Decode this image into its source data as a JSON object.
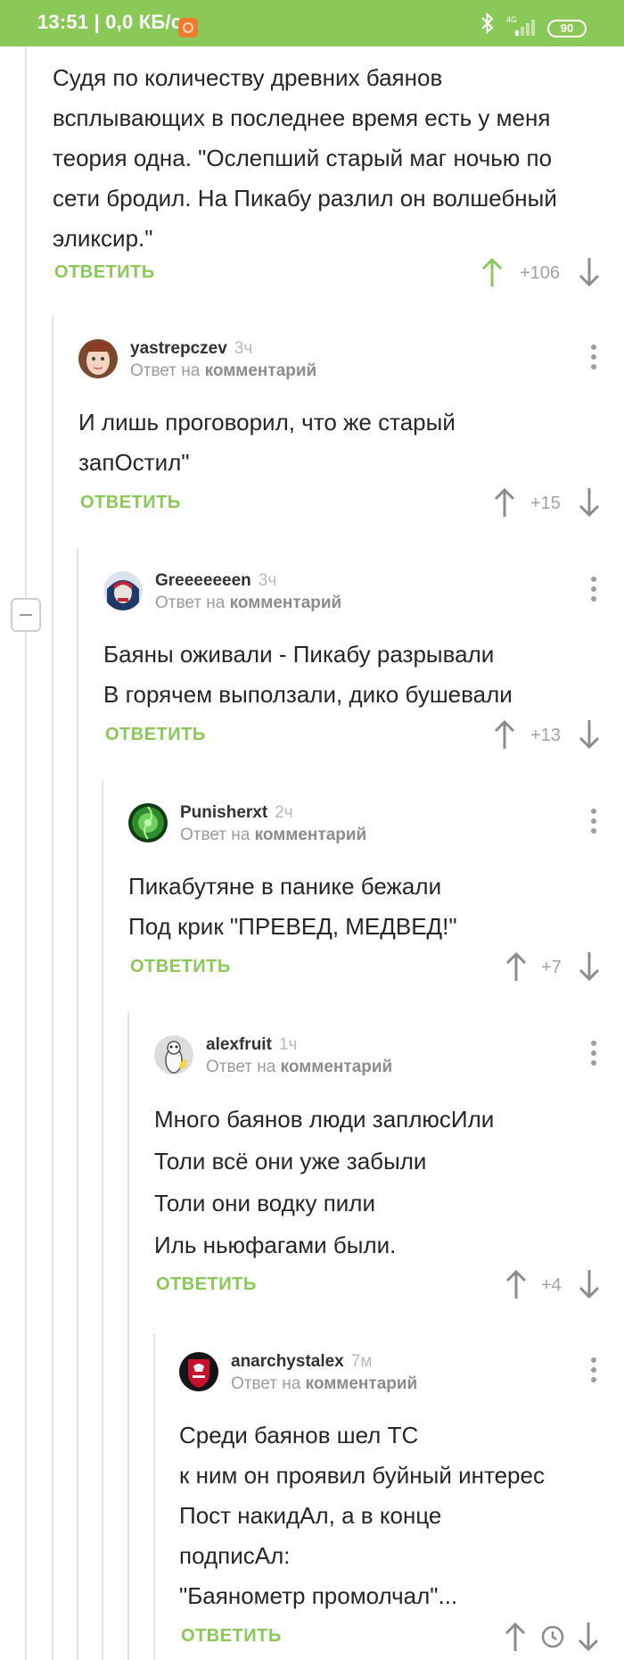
{
  "status_bar": {
    "time_speed": "13:51 | 0,0 КБ/с",
    "network": "4G",
    "battery": "90"
  },
  "icons": {
    "bluetooth": "bluetooth-icon",
    "signal": "signal-icon",
    "notification": "notification-icon",
    "menu": "more-vertical-icon",
    "upvote": "arrow-up-icon",
    "downvote": "arrow-down-icon",
    "collapse": "minus-icon",
    "pending": "clock-icon"
  },
  "colors": {
    "accent": "#8ac858",
    "text": "#262626",
    "muted": "#9c9c9c"
  },
  "reply_on": "Ответ на",
  "reply_target": "комментарий",
  "reply_label": "ОТВЕТИТЬ",
  "comments": [
    {
      "text": "Судя по количеству древних баянов всплывающих в последнее время есть у меня теория одна. \"Ослепший старый маг ночью по сети бродил. На Пикабу разлил он волшебный эликсир.\"",
      "score": "+106"
    },
    {
      "author": "yastrepczev",
      "time": "3ч",
      "text": "И лишь проговорил, что же старый запОстил\"",
      "score": "+15"
    },
    {
      "author": "Greeeeeeen",
      "time": "3ч",
      "text": "Баяны оживали - Пикабу разрывали\nВ горячем выползали, дико бушевали",
      "score": "+13"
    },
    {
      "author": "Punisherxt",
      "time": "2ч",
      "text": "Пикабутяне в панике бежали\nПод крик \"ПРЕВЕД, МЕДВЕД!\"",
      "score": "+7"
    },
    {
      "author": "alexfruit",
      "time": "1ч",
      "text": "Много баянов люди заплюсИли\nТоли всё они уже забыли\nТоли они водку пили\nИль ньюфагами были.",
      "score": "+4"
    },
    {
      "author": "anarchystalex",
      "time": "7м",
      "text": "Среди баянов шел ТС\nк ним он проявил буйный интерес\nПост накидАл, а в конце\nподписАл:\n\"Баянометр промолчал\"...",
      "score": ""
    }
  ]
}
